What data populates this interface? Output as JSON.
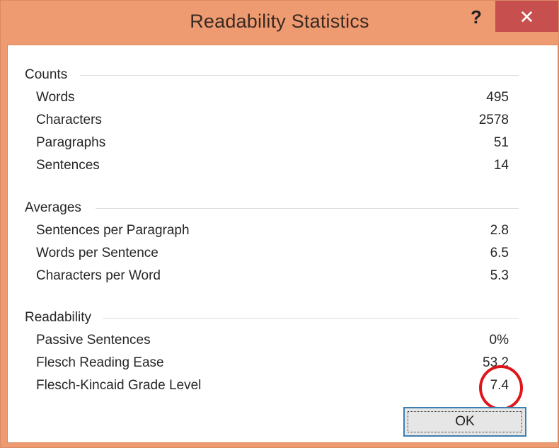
{
  "dialog": {
    "title": "Readability Statistics",
    "help_glyph": "?",
    "close_glyph": "✕",
    "ok_label": "OK"
  },
  "sections": {
    "counts": {
      "heading": "Counts",
      "rows": [
        {
          "label": "Words",
          "value": "495"
        },
        {
          "label": "Characters",
          "value": "2578"
        },
        {
          "label": "Paragraphs",
          "value": "51"
        },
        {
          "label": "Sentences",
          "value": "14"
        }
      ]
    },
    "averages": {
      "heading": "Averages",
      "rows": [
        {
          "label": "Sentences per Paragraph",
          "value": "2.8"
        },
        {
          "label": "Words per Sentence",
          "value": "6.5"
        },
        {
          "label": "Characters per Word",
          "value": "5.3"
        }
      ]
    },
    "readability": {
      "heading": "Readability",
      "rows": [
        {
          "label": "Passive Sentences",
          "value": "0%"
        },
        {
          "label": "Flesch Reading Ease",
          "value": "53.2"
        },
        {
          "label": "Flesch-Kincaid Grade Level",
          "value": "7.4"
        }
      ]
    }
  },
  "colors": {
    "title_bar": "#ef9b72",
    "close_button": "#c7504f",
    "highlight_circle": "#e0141b",
    "ok_border": "#3c7fb1"
  },
  "icons": {
    "help": "help-icon",
    "close": "close-icon"
  }
}
